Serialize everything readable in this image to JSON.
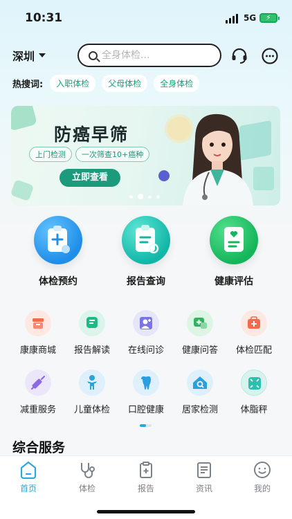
{
  "status_bar": {
    "time": "10:31",
    "network": "5G"
  },
  "header": {
    "city": "深圳",
    "search_placeholder": "全身体检..."
  },
  "hot_search": {
    "label": "热搜词:",
    "tags": [
      "入职体检",
      "父母体检",
      "全身体检"
    ]
  },
  "banner": {
    "title": "防癌早筛",
    "pills": [
      "上门检测",
      "一次筛查10+癌种"
    ],
    "button": "立即查看"
  },
  "main_services": [
    {
      "label": "体检预约",
      "icon": "clipboard-plus-icon"
    },
    {
      "label": "报告查询",
      "icon": "report-search-icon"
    },
    {
      "label": "健康评估",
      "icon": "heart-clipboard-icon"
    }
  ],
  "grid_services": [
    {
      "label": "康康商城",
      "icon": "shop-icon"
    },
    {
      "label": "报告解读",
      "icon": "report-chat-icon"
    },
    {
      "label": "在线问诊",
      "icon": "doctor-icon"
    },
    {
      "label": "健康问答",
      "icon": "qa-icon"
    },
    {
      "label": "体检匹配",
      "icon": "medkit-icon"
    },
    {
      "label": "减重服务",
      "icon": "syringe-icon"
    },
    {
      "label": "儿童体检",
      "icon": "child-icon"
    },
    {
      "label": "口腔健康",
      "icon": "tooth-icon"
    },
    {
      "label": "居家检测",
      "icon": "home-test-icon"
    },
    {
      "label": "体脂秤",
      "icon": "scale-icon"
    }
  ],
  "section": {
    "title": "综合服务"
  },
  "tabbar": {
    "items": [
      {
        "label": "首页",
        "icon": "home-icon"
      },
      {
        "label": "体检",
        "icon": "stethoscope-icon"
      },
      {
        "label": "报告",
        "icon": "report-icon"
      },
      {
        "label": "资讯",
        "icon": "news-icon"
      },
      {
        "label": "我的",
        "icon": "profile-icon"
      }
    ]
  },
  "colors": {
    "accent": "#2aa7de",
    "brand_green": "#1c9b7c",
    "tag_text": "#16a07c"
  }
}
